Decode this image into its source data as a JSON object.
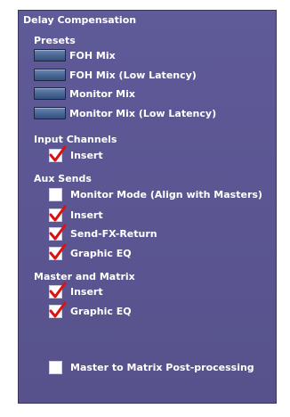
{
  "panel": {
    "title": "Delay Compensation"
  },
  "presets": {
    "heading": "Presets",
    "items": [
      {
        "label": "FOH Mix"
      },
      {
        "label": "FOH Mix (Low Latency)"
      },
      {
        "label": "Monitor Mix"
      },
      {
        "label": "Monitor Mix (Low Latency)"
      }
    ]
  },
  "input_channels": {
    "heading": "Input Channels",
    "items": [
      {
        "label": "Insert",
        "checked": true
      }
    ]
  },
  "aux_sends": {
    "heading": "Aux Sends",
    "items": [
      {
        "label": "Monitor Mode (Align with Masters)",
        "checked": false
      },
      {
        "label": "Insert",
        "checked": true
      },
      {
        "label": "Send-FX-Return",
        "checked": true
      },
      {
        "label": "Graphic EQ",
        "checked": true
      }
    ]
  },
  "master_matrix": {
    "heading": "Master and Matrix",
    "items": [
      {
        "label": "Insert",
        "checked": true
      },
      {
        "label": "Graphic EQ",
        "checked": true
      }
    ]
  },
  "post_processing": {
    "label": "Master to Matrix Post-processing",
    "checked": false
  },
  "colors": {
    "panel_bg": "#5b5692",
    "check_mark": "#dd1111",
    "preset_button": "#4f6b98",
    "text": "#ffffff"
  }
}
